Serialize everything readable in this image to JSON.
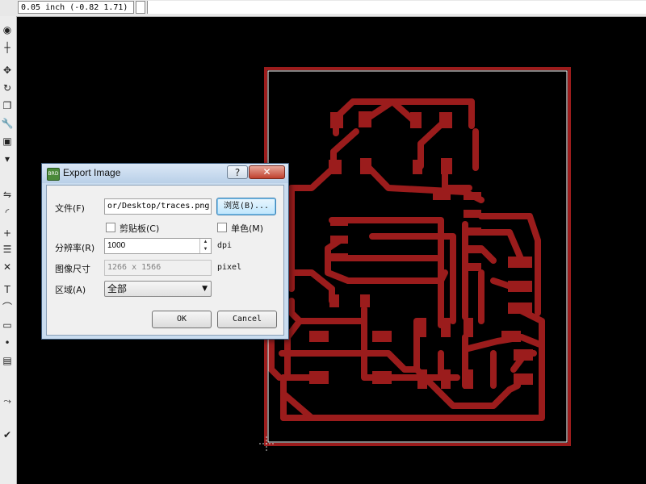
{
  "status_bar": {
    "coordinates": "0.05 inch (-0.82 1.71)"
  },
  "toolbar": {
    "icons": [
      "eye-icon",
      "grid-icon",
      "move-icon",
      "rotate-icon",
      "copy-icon",
      "wrench-icon",
      "group-icon",
      "paste-icon",
      "mirror-icon",
      "layers-icon",
      "arc-icon",
      "plus-icon",
      "list-icon",
      "cross-icon",
      "text-icon",
      "curve-icon",
      "rect-icon",
      "dot-line-icon",
      "attribute-icon",
      "route-icon",
      "drc-icon"
    ]
  },
  "dialog": {
    "title": "Export Image",
    "help_label": "?",
    "close_label": "✕",
    "file_label": "文件(F)",
    "file_value": "or/Desktop/traces.png",
    "browse_label": "浏览(B)...",
    "clipboard_label": "剪贴板(C)",
    "monochrome_label": "单色(M)",
    "resolution_label": "分辨率(R)",
    "resolution_value": "1000",
    "resolution_unit": "dpi",
    "image_size_label": "图像尺寸",
    "image_size_value": "1266 x 1566",
    "image_size_unit": "pixel",
    "area_label": "区域(A)",
    "area_value": "全部",
    "ok_label": "OK",
    "cancel_label": "Cancel"
  },
  "colors": {
    "trace": "#9b1c1c",
    "background": "#000000",
    "outline": "#ffffff"
  }
}
